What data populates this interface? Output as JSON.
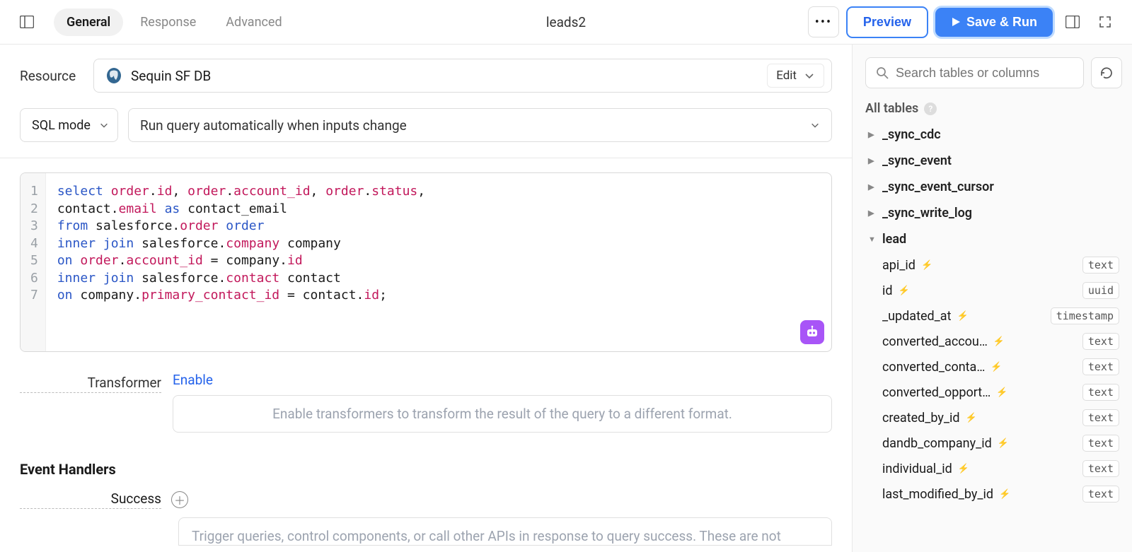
{
  "header": {
    "tabs": [
      "General",
      "Response",
      "Advanced"
    ],
    "active_tab_index": 0,
    "query_name": "leads2",
    "preview_label": "Preview",
    "run_label": "Save & Run"
  },
  "resource": {
    "label": "Resource",
    "name": "Sequin SF DB",
    "edit_label": "Edit"
  },
  "mode": {
    "sql_mode_label": "SQL mode",
    "run_mode_label": "Run query automatically when inputs change"
  },
  "code_lines": [
    [
      [
        "kw",
        "select"
      ],
      [
        "attr",
        " order"
      ],
      [
        "punc",
        "."
      ],
      [
        "attr",
        "id"
      ],
      [
        "punc",
        ", "
      ],
      [
        "attr",
        "order"
      ],
      [
        "punc",
        "."
      ],
      [
        "attr",
        "account_id"
      ],
      [
        "punc",
        ", "
      ],
      [
        "attr",
        "order"
      ],
      [
        "punc",
        "."
      ],
      [
        "attr",
        "status"
      ],
      [
        "punc",
        ","
      ]
    ],
    [
      [
        "punc",
        "contact"
      ],
      [
        "punc",
        "."
      ],
      [
        "attr",
        "email"
      ],
      [
        "punc",
        " "
      ],
      [
        "kw",
        "as"
      ],
      [
        "punc",
        " contact_email"
      ]
    ],
    [
      [
        "kw",
        "from"
      ],
      [
        "punc",
        " salesforce"
      ],
      [
        "punc",
        "."
      ],
      [
        "attr",
        "order"
      ],
      [
        "punc",
        " "
      ],
      [
        "kw",
        "order"
      ]
    ],
    [
      [
        "kw",
        "inner"
      ],
      [
        "punc",
        " "
      ],
      [
        "kw",
        "join"
      ],
      [
        "punc",
        " salesforce"
      ],
      [
        "punc",
        "."
      ],
      [
        "attr",
        "company"
      ],
      [
        "punc",
        " company"
      ]
    ],
    [
      [
        "kw",
        "on"
      ],
      [
        "punc",
        " "
      ],
      [
        "attr",
        "order"
      ],
      [
        "punc",
        "."
      ],
      [
        "attr",
        "account_id"
      ],
      [
        "punc",
        " = company"
      ],
      [
        "punc",
        "."
      ],
      [
        "attr",
        "id"
      ]
    ],
    [
      [
        "kw",
        "inner"
      ],
      [
        "punc",
        " "
      ],
      [
        "kw",
        "join"
      ],
      [
        "punc",
        " salesforce"
      ],
      [
        "punc",
        "."
      ],
      [
        "attr",
        "contact"
      ],
      [
        "punc",
        " contact"
      ]
    ],
    [
      [
        "kw",
        "on"
      ],
      [
        "punc",
        " company"
      ],
      [
        "punc",
        "."
      ],
      [
        "attr",
        "primary_contact_id"
      ],
      [
        "punc",
        " = contact"
      ],
      [
        "punc",
        "."
      ],
      [
        "attr",
        "id"
      ],
      [
        "punc",
        ";"
      ]
    ]
  ],
  "transformer": {
    "label": "Transformer",
    "enable_label": "Enable",
    "placeholder": "Enable transformers to transform the result of the query to a different format."
  },
  "event_handlers": {
    "header": "Event Handlers",
    "success_label": "Success",
    "placeholder": "Trigger queries, control components, or call other APIs in response to query success. These are not"
  },
  "schema": {
    "search_placeholder": "Search tables or columns",
    "all_tables_label": "All tables",
    "tables": [
      {
        "name": "_sync_cdc",
        "expanded": false
      },
      {
        "name": "_sync_event",
        "expanded": false
      },
      {
        "name": "_sync_event_cursor",
        "expanded": false
      },
      {
        "name": "_sync_write_log",
        "expanded": false
      },
      {
        "name": "lead",
        "expanded": true,
        "columns": [
          {
            "name": "api_id",
            "type": "text"
          },
          {
            "name": "id",
            "type": "uuid"
          },
          {
            "name": "_updated_at",
            "type": "timestamp"
          },
          {
            "name": "converted_accou…",
            "type": "text"
          },
          {
            "name": "converted_conta…",
            "type": "text"
          },
          {
            "name": "converted_opport…",
            "type": "text"
          },
          {
            "name": "created_by_id",
            "type": "text"
          },
          {
            "name": "dandb_company_id",
            "type": "text"
          },
          {
            "name": "individual_id",
            "type": "text"
          },
          {
            "name": "last_modified_by_id",
            "type": "text"
          }
        ]
      }
    ]
  }
}
